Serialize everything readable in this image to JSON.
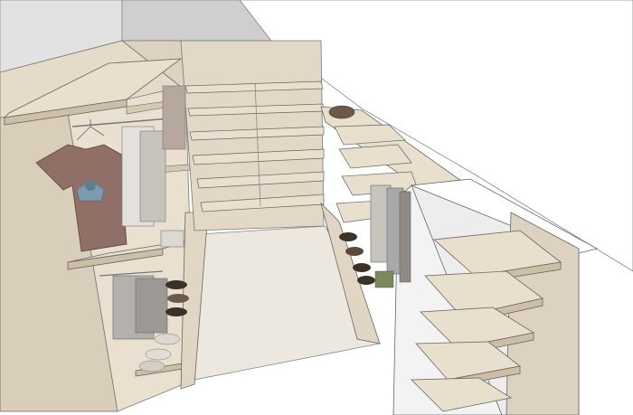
{
  "scene": {
    "subject": "walk-in-closet-render",
    "colors": {
      "background": "#ffffff",
      "wall": "#e3e3e3",
      "wall_dark": "#c9c9c9",
      "wood": "#e6dccb",
      "wood_edge": "#c7b9a1",
      "wood_shadow": "#d3c6b0",
      "outline": "#555555",
      "shirt": "#8f6f66",
      "shirt_dark": "#6f534c",
      "fabric_light": "#d8d6d2",
      "fabric_grey": "#a9a9a9",
      "shoe_dark": "#3c3126",
      "shoe_light": "#dcd7cf",
      "partition": "#f2f2f2"
    }
  }
}
